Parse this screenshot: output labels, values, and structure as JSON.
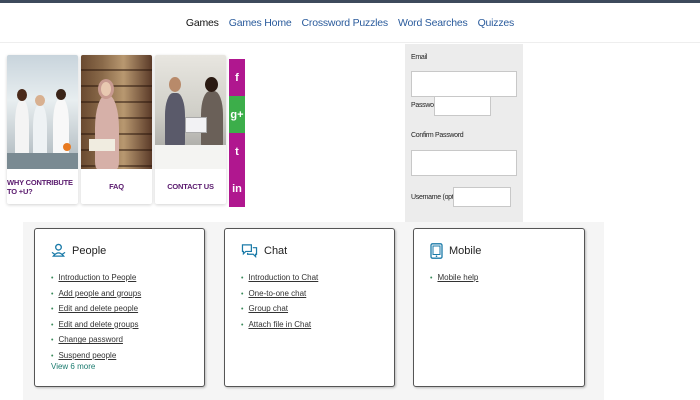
{
  "nav": {
    "items": [
      "Games",
      "Games Home",
      "Crossword Puzzles",
      "Word Searches",
      "Quizzes"
    ]
  },
  "cards": [
    {
      "caption": "WHY CONTRIBUTE TO +U?"
    },
    {
      "caption": "FAQ"
    },
    {
      "caption": "CONTACT US"
    }
  ],
  "social": {
    "facebook": "f",
    "googleplus": "g+",
    "twitter": "t",
    "linkedin": "in"
  },
  "form": {
    "email_label": "Email",
    "password_label": "Password",
    "confirm_label": "Confirm Password",
    "username_label": "Username (optional)"
  },
  "panels": {
    "people": {
      "title": "People",
      "links": [
        "Introduction to People",
        "Add people and groups",
        "Edit and delete people",
        "Edit and delete groups",
        "Change password",
        "Suspend people"
      ],
      "more": "View 6 more"
    },
    "chat": {
      "title": "Chat",
      "links": [
        "Introduction to Chat",
        "One-to-one chat",
        "Group chat",
        "Attach file in Chat"
      ]
    },
    "mobile": {
      "title": "Mobile",
      "links": [
        "Mobile help"
      ]
    }
  },
  "colors": {
    "accent_purple": "#b0178f",
    "accent_green": "#3cae4a",
    "link_blue": "#2a5b9c",
    "teal": "#1a7a6e"
  }
}
